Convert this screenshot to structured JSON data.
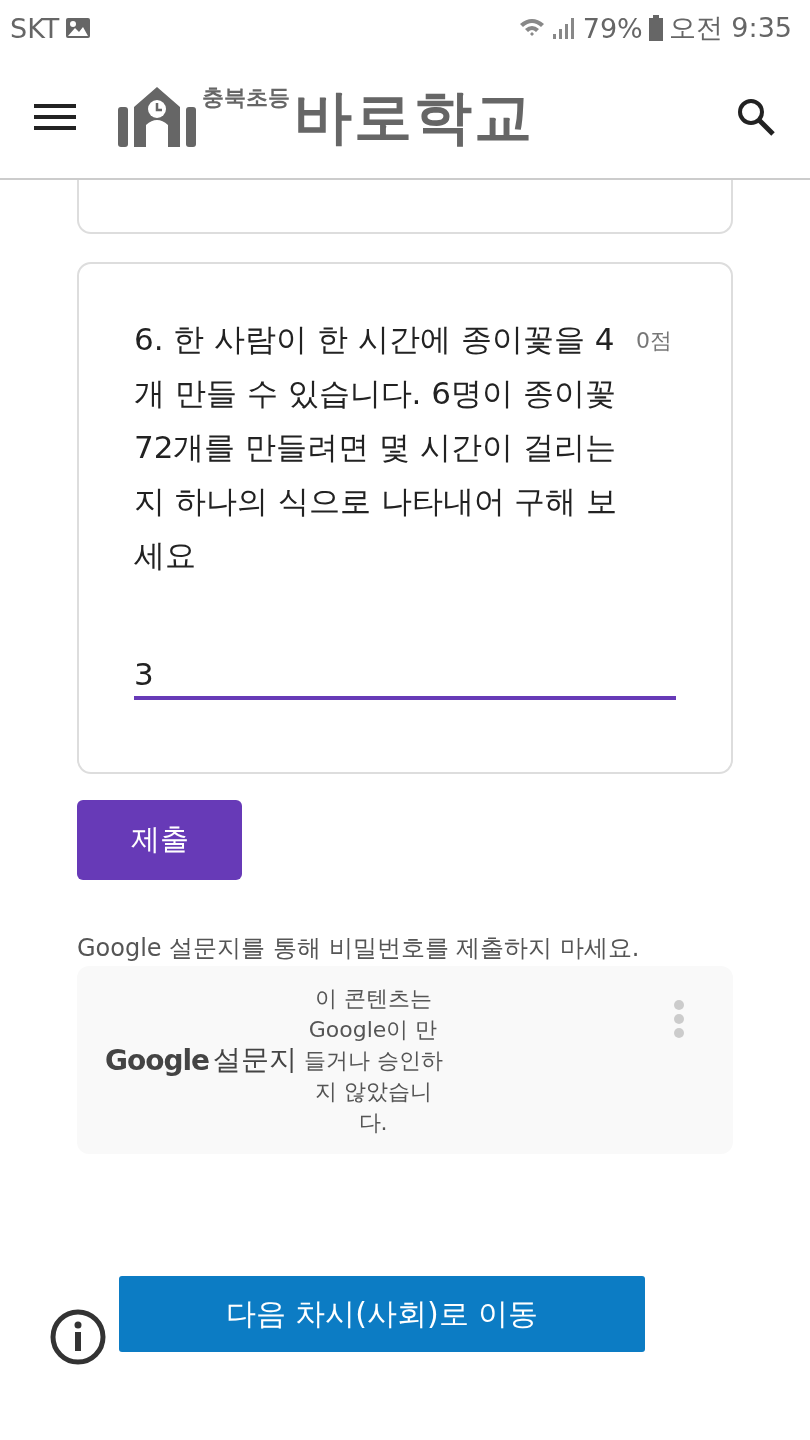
{
  "status_bar": {
    "carrier": "SKT",
    "battery": "79%",
    "time": "오전 9:35"
  },
  "header": {
    "logo_small": "충북초등",
    "logo_big": "바로학교"
  },
  "question": {
    "text": "6. 한 사람이 한 시간에 종이꽃을 4개 만들 수 있습니다. 6명이 종이꽃 72개를 만들려면 몇 시간이 걸리는지 하나의 식으로 나타내어 구해 보세요",
    "points": "0점",
    "answer": "3"
  },
  "submit_button": "제출",
  "password_note": "Google 설문지를 통해 비밀번호를 제출하지 마세요.",
  "footer": {
    "brand_google": "Google",
    "brand_forms": "설문지",
    "disclaimer": "이 콘텐츠는 Google이 만들거나 승인하지 않았습니다."
  },
  "next_button": "다음 차시(사회)로 이동"
}
